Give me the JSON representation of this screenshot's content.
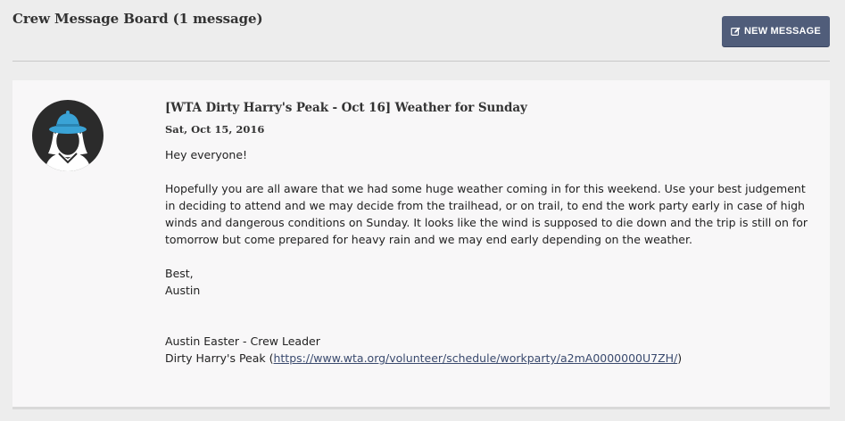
{
  "board": {
    "title": "Crew Message Board (1 message)",
    "new_message_label": "NEW MESSAGE"
  },
  "message": {
    "title": "[WTA Dirty Harry's Peak - Oct 16] Weather for Sunday",
    "date": "Sat, Oct 15, 2016",
    "greeting": "Hey everyone!",
    "paragraph": "Hopefully you are all aware that we had some huge weather coming in for this weekend. Use your best judgement in deciding to attend and we may decide from the trailhead, or on trail, to end the work party early in case of high winds and dangerous conditions on Sunday. It looks like the wind is supposed to die down and the trip is still on for tomorrow but come prepared for heavy rain and we may end early depending on the weather.",
    "signoff": "Best,",
    "signoff_name": "Austin",
    "signature_line": "Austin Easter - Crew Leader",
    "workparty_prefix": "Dirty Harry's Peak (",
    "workparty_link": "https://www.wta.org/volunteer/schedule/workparty/a2mA0000000U7ZH/",
    "workparty_suffix": ")"
  },
  "colors": {
    "button_bg": "#505d7a",
    "avatar_bg": "#2b2b2b",
    "hat": "#3aa3d6",
    "page_bg": "#ededed",
    "card_bg": "#f8f7f8"
  },
  "icons": {
    "new_message": "edit-icon",
    "avatar": "hiker-avatar"
  }
}
